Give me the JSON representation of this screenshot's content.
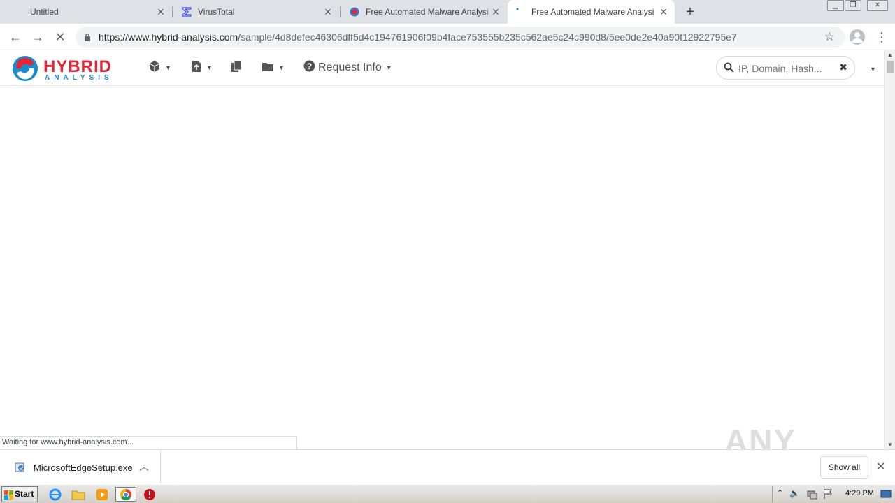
{
  "browser": {
    "tabs": [
      {
        "title": "Untitled",
        "favicon": "none"
      },
      {
        "title": "VirusTotal",
        "favicon": "virustotal-sigma-icon"
      },
      {
        "title": "Free Automated Malware Analysis Se",
        "favicon": "hybrid-analysis-icon"
      },
      {
        "title": "Free Automated Malware Analysis Se",
        "favicon": "loading-dot-icon"
      }
    ],
    "new_tab_label": "+",
    "url_host": "https://www.hybrid-analysis.com",
    "url_path": "/sample/4d8defec46306dff5d4c194761906f09b4face753555b235c562ae5c24c990d8/5ee0de2e40a90f12922795e7"
  },
  "site": {
    "logo_text_top": "HYBRID",
    "logo_text_bottom": "ANALYSIS",
    "request_info_label": "Request Info",
    "search_placeholder": "IP, Domain, Hash..."
  },
  "status_text": "Waiting for www.hybrid-analysis.com...",
  "watermark": "ANY RUN",
  "download": {
    "file_name": "MicrosoftEdgeSetup.exe",
    "show_all_label": "Show all"
  },
  "taskbar": {
    "start_label": "Start",
    "clock": "4:29 PM"
  },
  "colors": {
    "brand_red": "#e32636",
    "brand_blue": "#1f8ac9",
    "tabstrip": "#dee1e6"
  }
}
